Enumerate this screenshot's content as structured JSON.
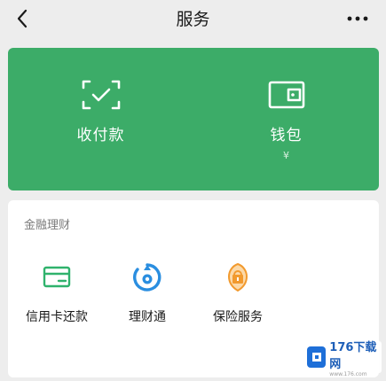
{
  "header": {
    "title": "服务",
    "back_icon": "chevron-left-icon",
    "more_icon": "more-dots-icon"
  },
  "wallet_panel": {
    "background_color": "#3cac68",
    "items": [
      {
        "label": "收付款",
        "icon": "scan-check-icon"
      },
      {
        "label": "钱包",
        "icon": "wallet-icon",
        "sub": "¥"
      }
    ]
  },
  "finance": {
    "section_title": "金融理财",
    "items": [
      {
        "label": "信用卡还款",
        "icon": "credit-card-icon",
        "color": "#2fb26c"
      },
      {
        "label": "理财通",
        "icon": "wealth-icon",
        "color": "#2a8ee0"
      },
      {
        "label": "保险服务",
        "icon": "insurance-icon",
        "color": "#f29a2e"
      }
    ]
  },
  "watermark": {
    "logo_text": "176下载网",
    "url": "www.176.com"
  }
}
